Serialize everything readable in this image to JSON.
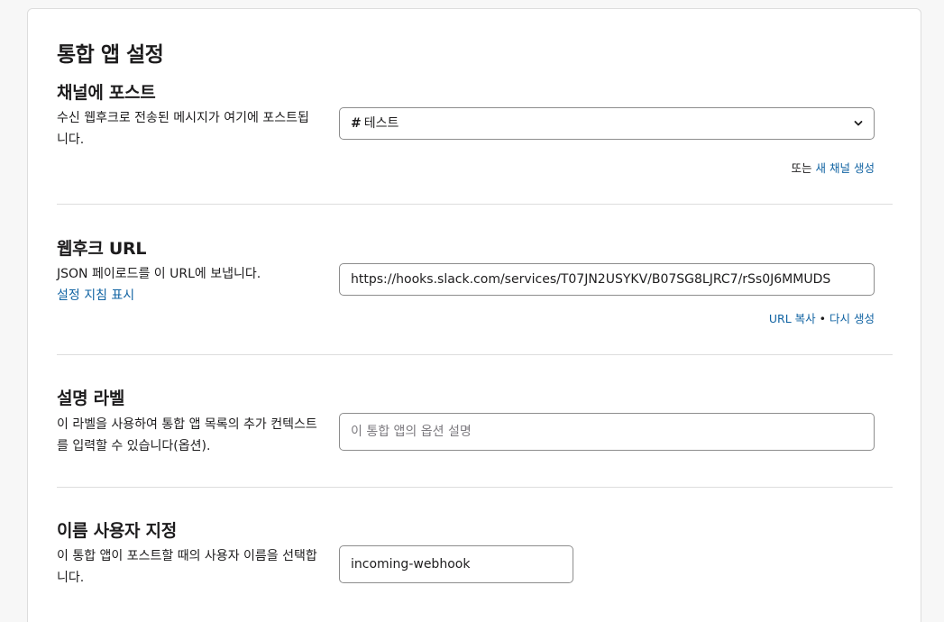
{
  "page": {
    "title": "통합 앱 설정"
  },
  "channel": {
    "title": "채널에 포스트",
    "description": "수신 웹후크로 전송된 메시지가 여기에 포스트됩니다.",
    "selected_prefix": "#",
    "selected_value": "테스트",
    "or_text": "또는",
    "create_link": "새 채널 생성"
  },
  "webhook": {
    "title": "웹후크 URL",
    "description": "JSON 페이로드를 이 URL에 보냅니다.",
    "instructions_link": "설정 지침 표시",
    "url": "https://hooks.slack.com/services/T07JN2USYKV/B07SG8LJRC7/rSs0J6MMUDS",
    "copy_link": "URL 복사",
    "separator": "•",
    "regenerate_link": "다시 생성"
  },
  "label": {
    "title": "설명 라벨",
    "description": "이 라벨을 사용하여 통합 앱 목록의 추가 컨텍스트를 입력할 수 있습니다(옵션).",
    "placeholder": "이 통합 앱의 옵션 설명"
  },
  "username": {
    "title": "이름 사용자 지정",
    "description": "이 통합 앱이 포스트할 때의 사용자 이름을 선택합니다.",
    "value": "incoming-webhook"
  }
}
